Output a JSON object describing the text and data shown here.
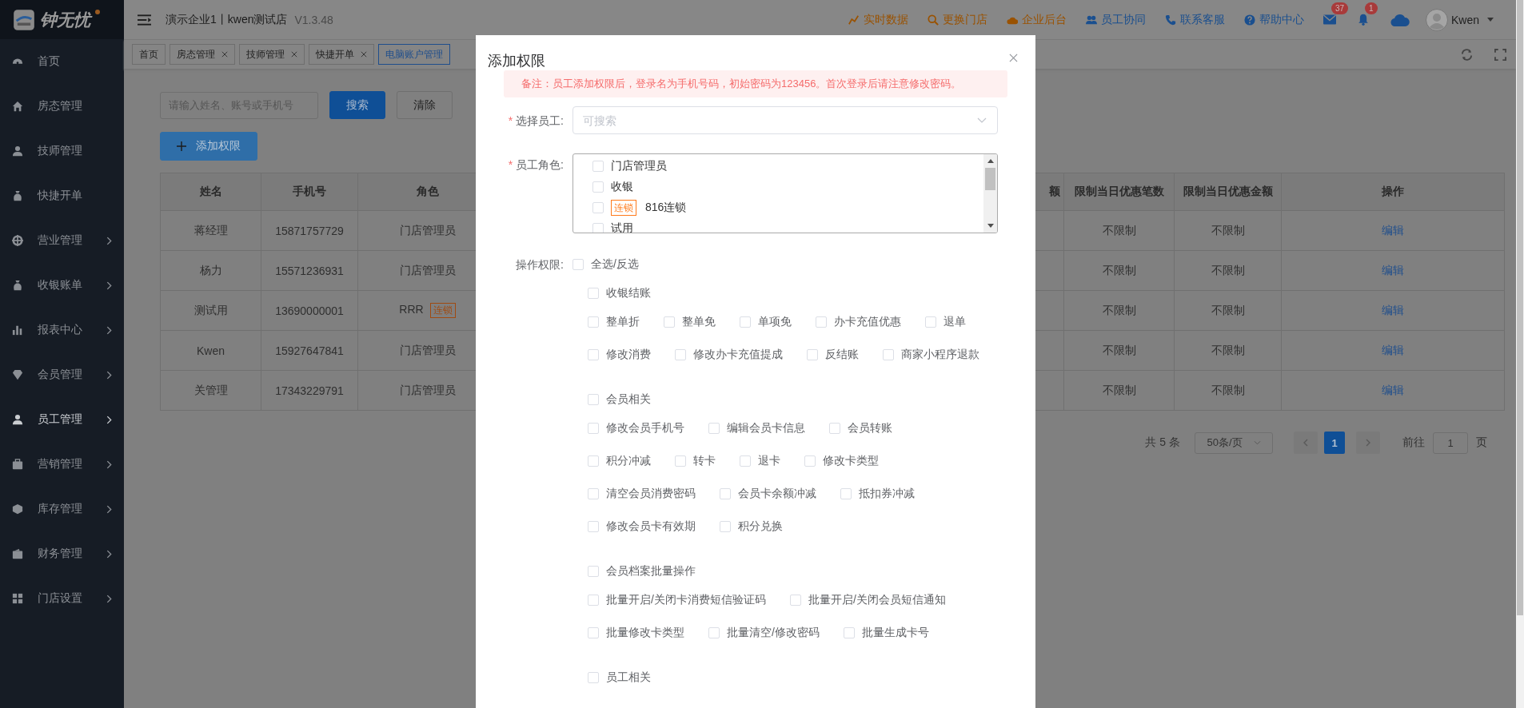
{
  "logo": {
    "text": "钟无忧"
  },
  "sidebar": {
    "items": [
      {
        "label": "首页",
        "expandable": false,
        "selected": false
      },
      {
        "label": "房态管理",
        "expandable": false,
        "selected": false
      },
      {
        "label": "技师管理",
        "expandable": false,
        "selected": false
      },
      {
        "label": "快捷开单",
        "expandable": false,
        "selected": false
      },
      {
        "label": "营业管理",
        "expandable": true,
        "selected": false
      },
      {
        "label": "收银账单",
        "expandable": true,
        "selected": false
      },
      {
        "label": "报表中心",
        "expandable": true,
        "selected": false
      },
      {
        "label": "会员管理",
        "expandable": true,
        "selected": false
      },
      {
        "label": "员工管理",
        "expandable": true,
        "selected": true
      },
      {
        "label": "营销管理",
        "expandable": true,
        "selected": false
      },
      {
        "label": "库存管理",
        "expandable": true,
        "selected": false
      },
      {
        "label": "财务管理",
        "expandable": true,
        "selected": false
      },
      {
        "label": "门店设置",
        "expandable": true,
        "selected": false
      }
    ]
  },
  "header": {
    "title": "演示企业1丨kwen测试店",
    "version": "V1.3.48",
    "links": [
      {
        "label": "实时数据",
        "color": "#9a5200"
      },
      {
        "label": "更换门店",
        "color": "#9a5200"
      },
      {
        "label": "企业后台",
        "color": "#9a5200"
      },
      {
        "label": "员工协同",
        "color": "#1a4f8f"
      },
      {
        "label": "联系客服",
        "color": "#1a4f8f"
      },
      {
        "label": "帮助中心",
        "color": "#1a4f8f"
      }
    ],
    "mail_badge": "37",
    "bell_badge": "1",
    "user": "Kwen"
  },
  "tabs": [
    {
      "label": "首页",
      "closable": false,
      "selected": false
    },
    {
      "label": "房态管理",
      "closable": true,
      "selected": false
    },
    {
      "label": "技师管理",
      "closable": true,
      "selected": false
    },
    {
      "label": "快捷开单",
      "closable": true,
      "selected": false
    },
    {
      "label": "电脑账户管理",
      "closable": false,
      "selected": true
    }
  ],
  "search": {
    "placeholder": "请输入姓名、账号或手机号",
    "search_button": "搜索",
    "clear_button": "清除"
  },
  "add_button": "添加权限",
  "table": {
    "columns": [
      "姓名",
      "手机号",
      "角色",
      "额",
      "限制当日优惠笔数",
      "限制当日优惠金额",
      "操作"
    ],
    "rows": [
      {
        "name": "蒋经理",
        "phone": "15871757729",
        "role": "门店管理员",
        "limit_count": "不限制",
        "limit_amount": "不限制",
        "action": "编辑"
      },
      {
        "name": "杨力",
        "phone": "15571236931",
        "role": "门店管理员",
        "limit_count": "不限制",
        "limit_amount": "不限制",
        "action": "编辑"
      },
      {
        "name": "测试用",
        "phone": "13690000001",
        "role": "RRR",
        "role_tag": "连锁",
        "limit_count": "不限制",
        "limit_amount": "不限制",
        "action": "编辑"
      },
      {
        "name": "Kwen",
        "phone": "15927647841",
        "role": "门店管理员",
        "limit_count": "不限制",
        "limit_amount": "不限制",
        "action": "编辑"
      },
      {
        "name": "关管理",
        "phone": "17343229791",
        "role": "门店管理员",
        "limit_count": "不限制",
        "limit_amount": "不限制",
        "action": "编辑"
      }
    ]
  },
  "pagination": {
    "total": "共 5 条",
    "page_size": "50条/页",
    "pages": [
      {
        "label": "1",
        "selected": true
      }
    ],
    "goto_label": "前往",
    "goto_value": "1",
    "goto_suffix": "页"
  },
  "dialog": {
    "title": "添加权限",
    "note": "备注：员工添加权限后，登录名为手机号码，初始密码为123456。首次登录后请注意修改密码。",
    "employee_required": "*",
    "employee_label": "选择员工:",
    "employee_placeholder": "可搜索",
    "roles_required": "*",
    "roles_label": "员工角色:",
    "roles": [
      {
        "label": "门店管理员",
        "checked": false
      },
      {
        "label": "收银",
        "checked": false
      },
      {
        "label": "816连锁",
        "tag": "连锁",
        "checked": false
      },
      {
        "label": "试用",
        "checked": false
      }
    ],
    "permissions_label": "操作权限:",
    "select_all": {
      "label": "全选/反选",
      "checked": false
    },
    "groups": [
      {
        "label": "收银结账",
        "checked": false,
        "lines": [
          {
            "options": [
              {
                "label": "整单折",
                "checked": false
              },
              {
                "label": "整单免",
                "checked": false
              },
              {
                "label": "单项免",
                "checked": false
              },
              {
                "label": "办卡充值优惠",
                "checked": false
              },
              {
                "label": "退单",
                "checked": false
              }
            ]
          },
          {
            "options": [
              {
                "label": "修改消费",
                "checked": false
              },
              {
                "label": "修改办卡充值提成",
                "checked": false
              },
              {
                "label": "反结账",
                "checked": false
              },
              {
                "label": "商家小程序退款",
                "checked": false
              }
            ]
          }
        ]
      },
      {
        "label": "会员相关",
        "checked": false,
        "lines": [
          {
            "options": [
              {
                "label": "修改会员手机号",
                "checked": false
              },
              {
                "label": "编辑会员卡信息",
                "checked": false
              },
              {
                "label": "会员转账",
                "checked": false
              }
            ]
          },
          {
            "options": [
              {
                "label": "积分冲减",
                "checked": false
              },
              {
                "label": "转卡",
                "checked": false
              },
              {
                "label": "退卡",
                "checked": false
              },
              {
                "label": "修改卡类型",
                "checked": false
              }
            ]
          },
          {
            "options": [
              {
                "label": "清空会员消费密码",
                "checked": false
              },
              {
                "label": "会员卡余额冲减",
                "checked": false
              },
              {
                "label": "抵扣券冲减",
                "checked": false
              }
            ]
          },
          {
            "options": [
              {
                "label": "修改会员卡有效期",
                "checked": false
              },
              {
                "label": "积分兑换",
                "checked": false
              }
            ]
          }
        ]
      },
      {
        "label": "会员档案批量操作",
        "checked": false,
        "lines": [
          {
            "options": [
              {
                "label": "批量开启/关闭卡消费短信验证码",
                "checked": false
              },
              {
                "label": "批量开启/关闭会员短信通知",
                "checked": false
              }
            ]
          },
          {
            "options": [
              {
                "label": "批量修改卡类型",
                "checked": false
              },
              {
                "label": "批量清空/修改密码",
                "checked": false
              },
              {
                "label": "批量生成卡号",
                "checked": false
              }
            ]
          }
        ]
      },
      {
        "label": "员工相关",
        "checked": false
      }
    ]
  }
}
